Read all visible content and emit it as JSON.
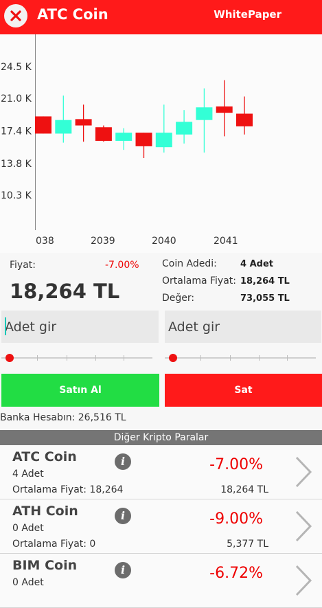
{
  "header": {
    "title": "ATC Coin",
    "whitepaper": "WhitePaper"
  },
  "chart_data": {
    "type": "candlestick",
    "y_ticks": [
      "24.5 K",
      "21.0 K",
      "17.4 K",
      "13.8 K",
      "10.3 K"
    ],
    "y_tick_values": [
      24500,
      21000,
      17400,
      13800,
      10300
    ],
    "x_ticks": [
      "038",
      "2039",
      "2040",
      "2041"
    ],
    "colors": {
      "up": "#33ffd6",
      "down": "#ee1111"
    },
    "candles": [
      {
        "open": 19000,
        "close": 17100,
        "high": 19000,
        "low": 17100
      },
      {
        "open": 17100,
        "close": 18600,
        "high": 21300,
        "low": 16100
      },
      {
        "open": 18700,
        "close": 18000,
        "high": 20300,
        "low": 16200
      },
      {
        "open": 17800,
        "close": 16300,
        "high": 18000,
        "low": 16200
      },
      {
        "open": 16300,
        "close": 17200,
        "high": 17700,
        "low": 15300
      },
      {
        "open": 17200,
        "close": 15700,
        "high": 17200,
        "low": 14400
      },
      {
        "open": 15600,
        "close": 17200,
        "high": 20300,
        "low": 15000
      },
      {
        "open": 17000,
        "close": 18400,
        "high": 19700,
        "low": 16000
      },
      {
        "open": 18600,
        "close": 20000,
        "high": 22100,
        "low": 15000
      },
      {
        "open": 20100,
        "close": 19400,
        "high": 23000,
        "low": 16800
      },
      {
        "open": 19300,
        "close": 17900,
        "high": 21200,
        "low": 17000
      }
    ]
  },
  "info": {
    "price_label": "Fiyat:",
    "change": "-7.00%",
    "price": "18,264 TL",
    "coin_count_label": "Coin Adedi:",
    "coin_count": "4 Adet",
    "avg_price_label": "Ortalama Fiyat:",
    "avg_price": "18,264 TL",
    "value_label": "Değer:",
    "value": "73,055 TL"
  },
  "trade": {
    "buy_placeholder": "Adet gir",
    "sell_placeholder": "Adet gir",
    "buy_label": "Satın Al",
    "sell_label": "Sat",
    "buy_color": "#22dd44",
    "sell_color": "#ff1a1a"
  },
  "bank": {
    "text": "Banka Hesabın: 26,516 TL"
  },
  "other": {
    "title": "Diğer Kripto Paralar",
    "coins": [
      {
        "name": "ATC Coin",
        "amount": "4 Adet",
        "avg": "Ortalama Fiyat: 18,264",
        "change": "-7.00%",
        "value": "18,264 TL"
      },
      {
        "name": "ATH Coin",
        "amount": "0 Adet",
        "avg": "Ortalama Fiyat: 0",
        "change": "-9.00%",
        "value": "5,377 TL"
      },
      {
        "name": "BIM Coin",
        "amount": "0 Adet",
        "avg": "",
        "change": "-6.72%",
        "value": ""
      }
    ]
  }
}
